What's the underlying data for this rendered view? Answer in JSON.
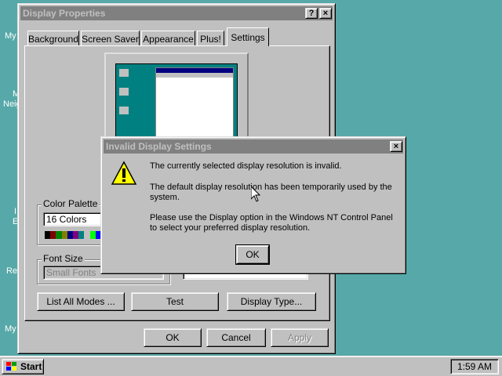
{
  "desktop": {
    "labels": [
      "My",
      "M",
      "Neig",
      "I",
      "E",
      "Re",
      "My"
    ]
  },
  "display_properties": {
    "title": "Display Properties",
    "title_buttons": {
      "help": "?",
      "close": "×"
    },
    "tabs": [
      {
        "label": "Background"
      },
      {
        "label": "Screen Saver"
      },
      {
        "label": "Appearance"
      },
      {
        "label": "Plus!"
      },
      {
        "label": "Settings"
      }
    ],
    "color_palette": {
      "group_label": "Color Palette",
      "selected": "16 Colors",
      "swatches": [
        "#000000",
        "#800000",
        "#008000",
        "#808000",
        "#000080",
        "#800080",
        "#008080",
        "#c0c0c0",
        "#00ff00",
        "#0000ff"
      ]
    },
    "font_size": {
      "group_label": "Font Size",
      "selected": "Small Fonts"
    },
    "buttons": {
      "list_all_modes": "List All Modes ...",
      "test": "Test",
      "display_type": "Display Type..."
    },
    "footer": {
      "ok": "OK",
      "cancel": "Cancel",
      "apply": "Apply"
    }
  },
  "dialog": {
    "title": "Invalid Display Settings",
    "close": "×",
    "icon": "warning-icon",
    "message1": "The currently selected display resolution is invalid.",
    "message2": "The default display resolution has been temporarily used by the system.",
    "message3": "Please use the Display option in the Windows NT Control Panel to select your preferred display resolution.",
    "ok": "OK"
  },
  "taskbar": {
    "start": "Start",
    "clock": "1:59 AM"
  },
  "colors": {
    "desktop": "#57a8a8",
    "face": "#c0c0c0",
    "active_title": "#000080",
    "inactive_title": "#808080"
  }
}
